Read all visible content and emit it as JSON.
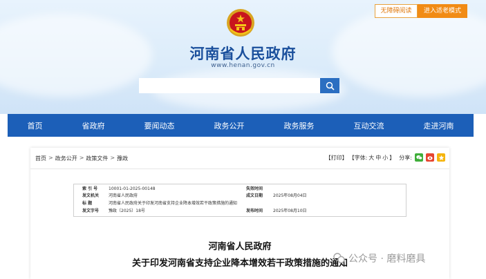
{
  "top_buttons": {
    "accessible": "无障碍阅读",
    "elder_mode": "进入适老模式"
  },
  "header": {
    "site_title": "河南省人民政府",
    "site_url": "www.henan.gov.cn"
  },
  "search": {
    "value": "",
    "placeholder": ""
  },
  "nav": [
    "首页",
    "省政府",
    "要闻动态",
    "政务公开",
    "政务服务",
    "互动交流",
    "走进河南"
  ],
  "breadcrumb": [
    "首页",
    "政务公开",
    "政策文件",
    "豫政"
  ],
  "tools": {
    "print": "【打印】",
    "font_label": "【字体:",
    "font_large": "大",
    "font_medium": "中",
    "font_small": "小",
    "font_close": "】",
    "share": "分享:"
  },
  "meta": {
    "index_label": "索 引 号",
    "index_value": "10001-01-2025-00148",
    "expire_label": "失效时间",
    "expire_value": "",
    "issuer_label": "发文机关",
    "issuer_value": "河南省人民政府",
    "created_label": "成文日期",
    "created_value": "2025年08月04日",
    "title_label": "标 题",
    "title_value": "河南省人民政府关于印发河南省支持企业降本增效若干政策措施的通知",
    "doc_no_label": "发文字号",
    "doc_no_value": "豫政〔2025〕18号",
    "published_label": "发布时间",
    "published_value": "2025年08月10日"
  },
  "document": {
    "title_line1": "河南省人民政府",
    "title_line2": "关于印发河南省支持企业降本增效若干政策措施的通知"
  },
  "watermark": "公众号 · 磨料磨具",
  "colors": {
    "nav_blue": "#1c5fb8",
    "title_blue": "#1a4f9c",
    "orange": "#f18b15"
  }
}
